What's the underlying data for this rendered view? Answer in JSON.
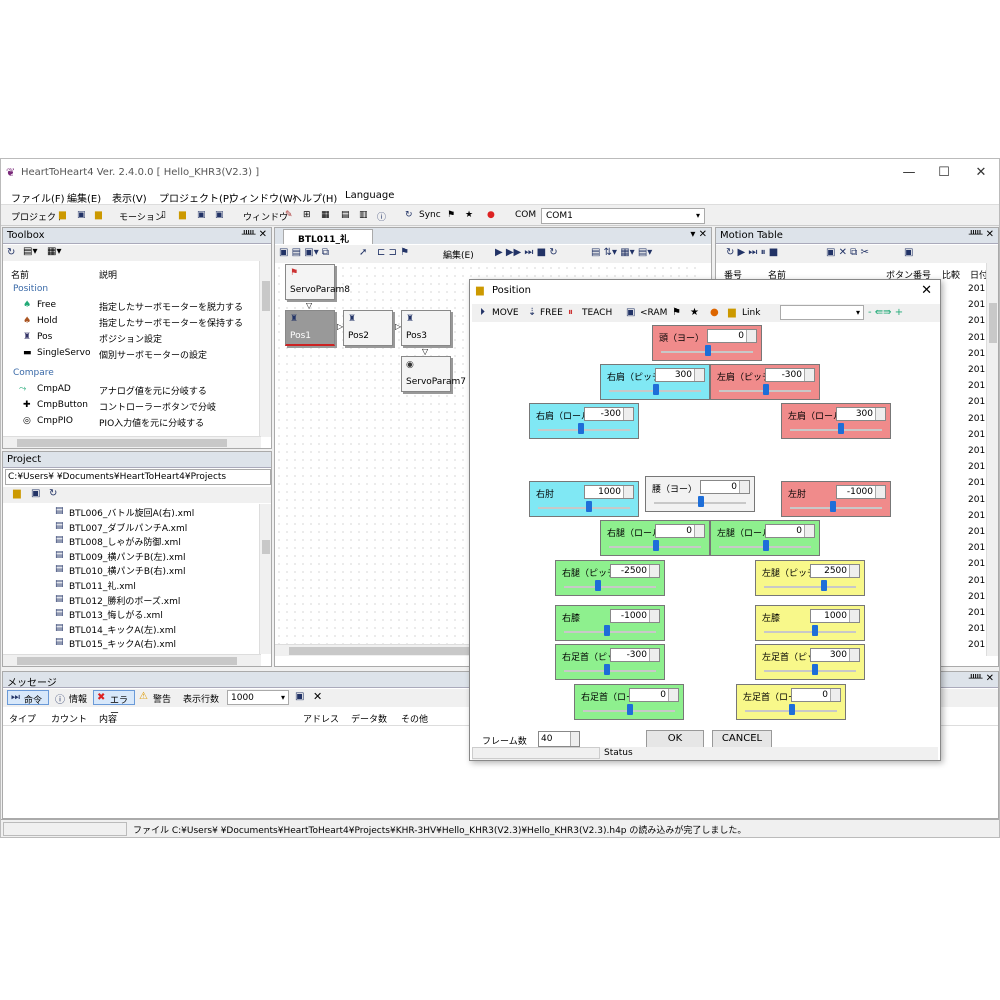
{
  "window": {
    "title": "HeartToHeart4 Ver. 2.4.0.0 [ Hello_KHR3(V2.3) ]",
    "min": "—",
    "max": "☐",
    "close": "✕"
  },
  "menu": [
    "ファイル(F)",
    "編集(E)",
    "表示(V)",
    "プロジェクト(P)",
    "ウィンドウ(W)",
    "ヘルプ(H)",
    "Language"
  ],
  "toolbar": {
    "project": "プロジェクト",
    "motion": "モーション",
    "window": "ウィンドウ",
    "sync": "Sync",
    "com_label": "COM",
    "com_value": "COM1"
  },
  "toolbox": {
    "title": "Toolbox",
    "col_name": "名前",
    "col_desc": "説明",
    "groups": [
      {
        "name": "Position",
        "items": [
          {
            "name": "Free",
            "desc": "指定したサーボモーターを脱力する"
          },
          {
            "name": "Hold",
            "desc": "指定したサーボモーターを保持する"
          },
          {
            "name": "Pos",
            "desc": "ポジション設定"
          },
          {
            "name": "SingleServo",
            "desc": "個別サーボモーターの設定"
          }
        ]
      },
      {
        "name": "Compare",
        "items": [
          {
            "name": "CmpAD",
            "desc": "アナログ値を元に分岐する"
          },
          {
            "name": "CmpButton",
            "desc": "コントローラーボタンで分岐"
          },
          {
            "name": "CmpPIO",
            "desc": "PIO入力値を元に分岐する"
          }
        ]
      }
    ]
  },
  "project": {
    "title": "Project",
    "path": "C:¥Users¥            ¥Documents¥HeartToHeart4¥Projects",
    "files": [
      "BTL006_バトル旋回A(右).xml",
      "BTL007_ダブルパンチA.xml",
      "BTL008_しゃがみ防御.xml",
      "BTL009_横パンチB(左).xml",
      "BTL010_横パンチB(右).xml",
      "BTL011_礼.xml",
      "BTL012_勝利のポーズ.xml",
      "BTL013_悔しがる.xml",
      "BTL014_キックA(左).xml",
      "BTL015_キックA(右).xml"
    ]
  },
  "editor": {
    "tab": "BTL011_礼",
    "edit_label": "編集(E)",
    "nodes": [
      {
        "id": "servo8",
        "label": "ServoParam8"
      },
      {
        "id": "pos1",
        "label": "Pos1"
      },
      {
        "id": "pos2",
        "label": "Pos2"
      },
      {
        "id": "pos3",
        "label": "Pos3"
      },
      {
        "id": "servo7",
        "label": "ServoParam7"
      }
    ]
  },
  "motion_table": {
    "title": "Motion Table",
    "col_num": "番号",
    "col_name": "名前",
    "col_btn": "ボタン番号",
    "col_cmp": "比較",
    "col_date": "日付",
    "dates": [
      "201",
      "201",
      "201",
      "201",
      "201",
      "201",
      "201",
      "201",
      "201",
      "201",
      "201",
      "201",
      "201",
      "201",
      "201",
      "201",
      "201",
      "201",
      "201",
      "201",
      "201",
      "201",
      "201"
    ]
  },
  "messages": {
    "title": "メッセージ",
    "cmd": "命令",
    "info": "情報",
    "error": "エラー",
    "warn": "警告",
    "rows_label": "表示行数",
    "rows_value": "1000",
    "cols": [
      "タイプ",
      "カウント",
      "内容",
      "アドレス",
      "データ数",
      "その他"
    ]
  },
  "status": "ファイル C:¥Users¥            ¥Documents¥HeartToHeart4¥Projects¥KHR-3HV¥Hello_KHR3(V2.3)¥Hello_KHR3(V2.3).h4p の読み込みが完了しました。",
  "position_dialog": {
    "title": "Position",
    "move": "MOVE",
    "free": "FREE",
    "teach": "TEACH",
    "ram": "<RAM",
    "link": "Link",
    "servos": [
      {
        "label": "頭（ヨー）",
        "value": "0",
        "level": 0.5,
        "color": "red"
      },
      {
        "label": "右肩（ピッチ）",
        "value": "300",
        "level": 0.5,
        "color": "cyan"
      },
      {
        "label": "左肩（ピッチ）",
        "value": "-300",
        "level": 0.5,
        "color": "red"
      },
      {
        "label": "右肩（ロール）",
        "value": "-300",
        "level": 0.45,
        "color": "cyan"
      },
      {
        "label": "左肩（ロール）",
        "value": "300",
        "level": 0.55,
        "color": "red"
      },
      {
        "label": "右肘",
        "value": "1000",
        "level": 0.55,
        "color": "cyan"
      },
      {
        "label": "腰（ヨー）",
        "value": "0",
        "level": 0.5,
        "color": "gray"
      },
      {
        "label": "左肘",
        "value": "-1000",
        "level": 0.45,
        "color": "red"
      },
      {
        "label": "右腿（ロール）",
        "value": "0",
        "level": 0.5,
        "color": "green"
      },
      {
        "label": "左腿（ロール）",
        "value": "0",
        "level": 0.5,
        "color": "green"
      },
      {
        "label": "右腿（ピッチ）",
        "value": "-2500",
        "level": 0.35,
        "color": "green"
      },
      {
        "label": "左腿（ピッチ）",
        "value": "2500",
        "level": 0.65,
        "color": "yellow"
      },
      {
        "label": "右膝",
        "value": "-1000",
        "level": 0.45,
        "color": "green"
      },
      {
        "label": "左膝",
        "value": "1000",
        "level": 0.55,
        "color": "yellow"
      },
      {
        "label": "右足首（ピッチ）",
        "value": "-300",
        "level": 0.45,
        "color": "green"
      },
      {
        "label": "左足首（ピッチ）",
        "value": "300",
        "level": 0.55,
        "color": "yellow"
      },
      {
        "label": "右足首（ロール）",
        "value": "0",
        "level": 0.5,
        "color": "green"
      },
      {
        "label": "左足首（ロール）",
        "value": "0",
        "level": 0.5,
        "color": "yellow"
      }
    ],
    "frame_label": "フレーム数",
    "frame_value": "40",
    "ok": "OK",
    "cancel": "CANCEL",
    "status_label": "Status"
  }
}
